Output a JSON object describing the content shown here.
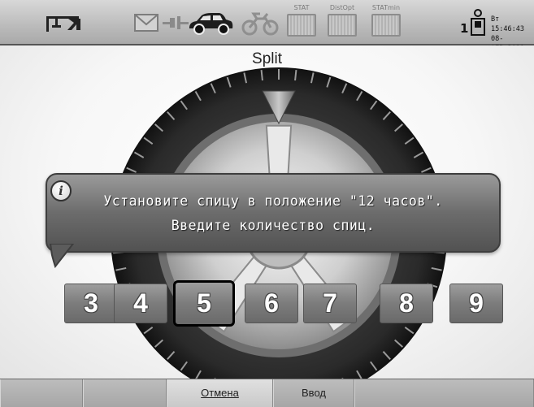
{
  "header": {
    "user_count": "1",
    "clock_line1": "Вт 15:46:43",
    "clock_line2": "08-ФЕВ-2011",
    "stat_labels": [
      "STAT",
      "DistOpt",
      "STATmin"
    ]
  },
  "screen": {
    "title": "Split"
  },
  "dialog": {
    "line1": "Установите спицу в положение \"12 часов\".",
    "line2": "Введите количество спиц."
  },
  "spoke_options": [
    "3",
    "4",
    "5",
    "6",
    "7",
    "8",
    "9"
  ],
  "selected_spoke": "5",
  "footer": {
    "cancel_label": "Отмена",
    "enter_label": "Ввод"
  }
}
